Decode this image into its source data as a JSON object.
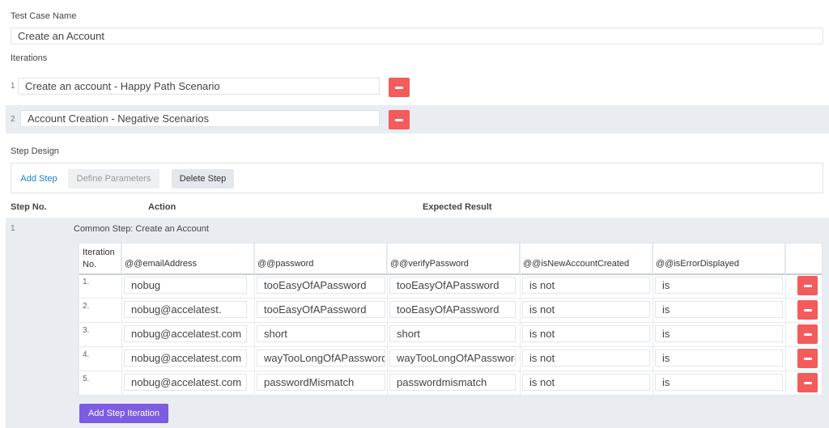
{
  "test_case": {
    "label": "Test Case Name",
    "value": "Create an Account"
  },
  "iterations": {
    "label": "Iterations",
    "items": [
      {
        "num": "1",
        "value": "Create an account - Happy Path Scenario"
      },
      {
        "num": "2",
        "value": "Account Creation - Negative Scenarios"
      }
    ]
  },
  "step_design": {
    "label": "Step Design",
    "add_step": "Add Step",
    "define_parameters": "Define Parameters",
    "delete_step": "Delete Step"
  },
  "steps_header": {
    "step_no": "Step No.",
    "action": "Action",
    "expected_result": "Expected Result"
  },
  "step": {
    "num": "1",
    "action": "Common Step: Create an Account"
  },
  "param_table": {
    "headers": {
      "iteration_no": "Iteration No.",
      "email": "@@emailAddress",
      "password": "@@password",
      "verify": "@@verifyPassword",
      "new_account": "@@isNewAccountCreated",
      "error": "@@isErrorDisplayed"
    },
    "rows": [
      {
        "num": "1.",
        "email": "nobug",
        "password": "tooEasyOfAPassword",
        "verify": "tooEasyOfAPassword",
        "new_account": "is not",
        "error": "is"
      },
      {
        "num": "2.",
        "email": "nobug@accelatest.",
        "password": "tooEasyOfAPassword",
        "verify": "tooEasyOfAPassword",
        "new_account": "is not",
        "error": "is"
      },
      {
        "num": "3.",
        "email": "nobug@accelatest.com",
        "password": "short",
        "verify": "short",
        "new_account": "is not",
        "error": "is"
      },
      {
        "num": "4.",
        "email": "nobug@accelatest.com",
        "password": "wayTooLongOfAPassword",
        "verify": "wayTooLongOfAPassword",
        "new_account": "is not",
        "error": "is"
      },
      {
        "num": "5.",
        "email": "nobug@accelatest.com",
        "password": "passwordMismatch",
        "verify": "passwordmismatch",
        "new_account": "is not",
        "error": "is"
      }
    ]
  },
  "add_step_iteration": "Add Step Iteration",
  "colors": {
    "accent_blue": "#1a7fd4",
    "delete_red": "#f45b5b",
    "purple_button": "#7c5ce0",
    "band_gray": "#e9edf1"
  }
}
